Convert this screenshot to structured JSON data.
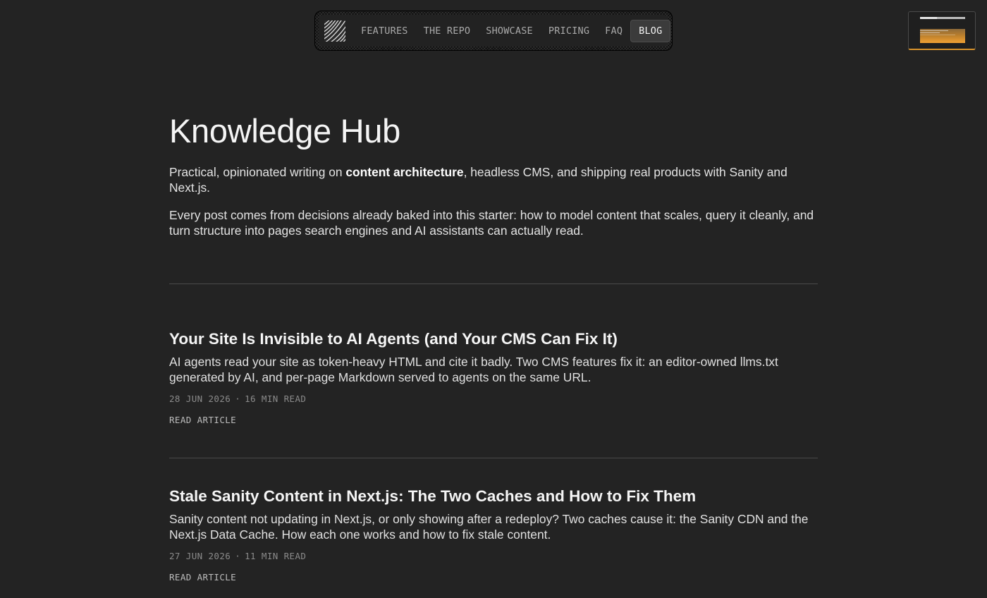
{
  "nav": {
    "logo_icon": "hatched-logo-icon",
    "items": [
      {
        "label": "FEATURES",
        "active": false
      },
      {
        "label": "THE REPO",
        "active": false
      },
      {
        "label": "SHOWCASE",
        "active": false
      },
      {
        "label": "PRICING",
        "active": false
      },
      {
        "label": "FAQ",
        "active": false
      },
      {
        "label": "BLOG",
        "active": true
      }
    ]
  },
  "page": {
    "title": "Knowledge Hub",
    "intro_1_before": "Practical, opinionated writing on ",
    "intro_1_bold": "content architecture",
    "intro_1_after": ", headless CMS, and shipping real products with Sanity and Next.js.",
    "intro_2": "Every post comes from decisions already baked into this starter: how to model content that scales, query it cleanly, and turn structure into pages search engines and AI assistants can actually read."
  },
  "posts": [
    {
      "title": "Your Site Is Invisible to AI Agents (and Your CMS Can Fix It)",
      "excerpt": "AI agents read your site as token-heavy HTML and cite it badly. Two CMS features fix it: an editor-owned llms.txt generated by AI, and per-page Markdown served to agents on the same URL.",
      "date": "28 JUN 2026",
      "separator": "·",
      "read_time": "16 MIN READ",
      "cta": "READ ARTICLE"
    },
    {
      "title": "Stale Sanity Content in Next.js: The Two Caches and How to Fix Them",
      "excerpt": "Sanity content not updating in Next.js, or only showing after a redeploy? Two caches cause it: the Sanity CDN and the Next.js Data Cache. How each one works and how to fix stale content.",
      "date": "27 JUN 2026",
      "separator": "·",
      "read_time": "11 MIN READ",
      "cta": "READ ARTICLE"
    }
  ],
  "colors": {
    "background": "#232323",
    "accent": "#d9932b",
    "text": "#ececec",
    "muted": "#8b8b8b"
  }
}
